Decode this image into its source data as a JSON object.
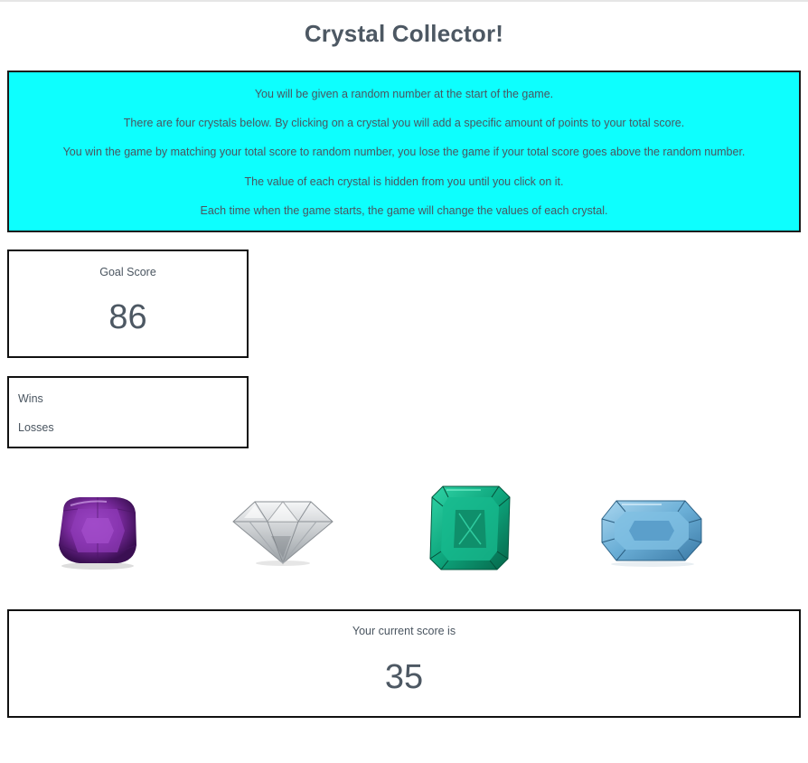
{
  "title": "Crystal Collector!",
  "instructions": [
    "You will be given a random number at the start of the game.",
    "There are four crystals below. By clicking on a crystal you will add a specific amount of points to your total score.",
    "You win the game by matching your total score to random number, you lose the game if your total score goes above the random number.",
    "The value of each crystal is hidden from you until you click on it.",
    "Each time when the game starts, the game will change the values of each crystal."
  ],
  "goal": {
    "label": "Goal Score",
    "value": "86"
  },
  "record": {
    "wins_label": "Wins",
    "losses_label": "Losses"
  },
  "crystals": [
    {
      "name": "amethyst",
      "color": "#7b2fa0"
    },
    {
      "name": "diamond",
      "color": "#d9dde0"
    },
    {
      "name": "emerald",
      "color": "#12b58a"
    },
    {
      "name": "aquamarine",
      "color": "#6fb3d8"
    }
  ],
  "score": {
    "label": "Your current score is",
    "value": "35"
  },
  "colors": {
    "instructions_bg": "#0dfffe",
    "text": "#4a5560"
  }
}
